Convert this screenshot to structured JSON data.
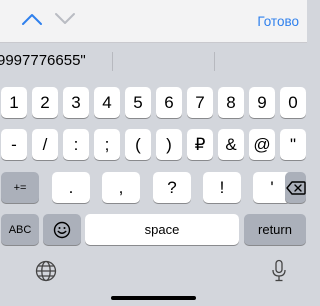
{
  "accessory": {
    "up_icon": "chevron-up-icon",
    "down_icon": "chevron-down-icon",
    "done_label": "Готово",
    "accent": "#2f80ed"
  },
  "suggestion": {
    "text": "9997776655\""
  },
  "keyboard": {
    "row1": [
      "1",
      "2",
      "3",
      "4",
      "5",
      "6",
      "7",
      "8",
      "9",
      "0"
    ],
    "row2": [
      "-",
      "/",
      ":",
      ";",
      "(",
      ")",
      "₽",
      "&",
      "@",
      "\""
    ],
    "row3": {
      "shift_label": "+=",
      "keys": [
        ".",
        ",",
        "?",
        "!",
        "'"
      ],
      "backspace_icon": "backspace-icon"
    },
    "row4": {
      "abc_label": "ABC",
      "emoji_icon": "emoji-icon",
      "space_label": "space",
      "return_label": "return"
    },
    "bottom": {
      "globe_icon": "globe-icon",
      "mic_icon": "microphone-icon"
    }
  }
}
